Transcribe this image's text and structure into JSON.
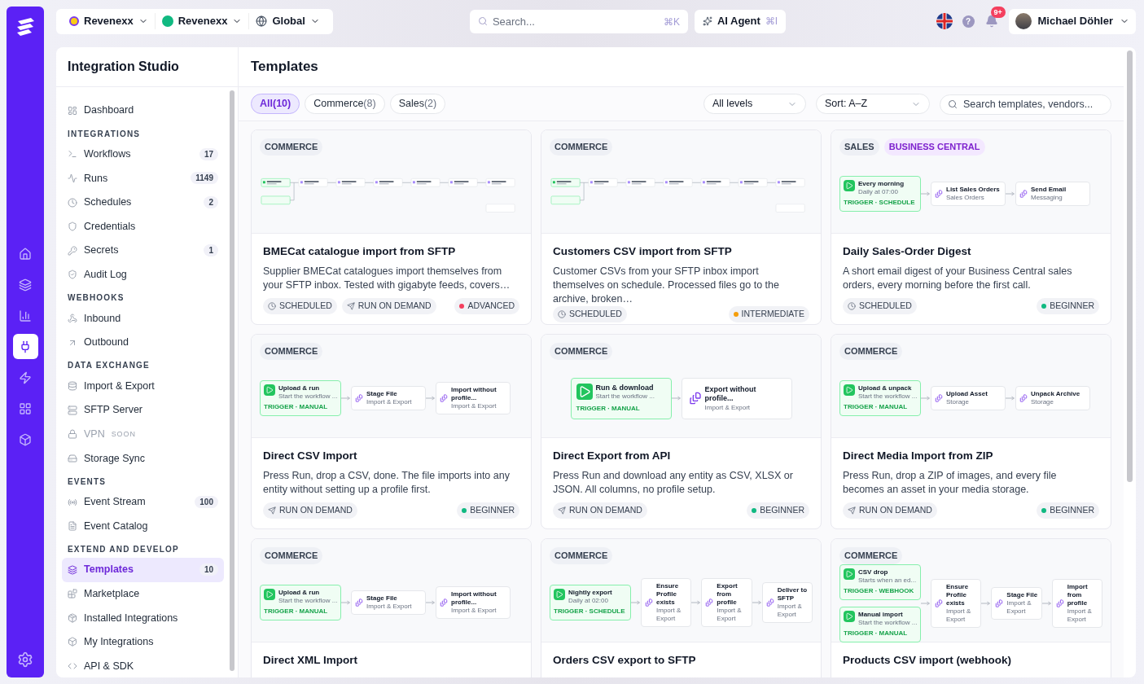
{
  "rail": [
    {
      "selected": false
    },
    {
      "selected": false
    },
    {
      "selected": false
    },
    {
      "selected": true
    },
    {
      "selected": false
    },
    {
      "selected": false
    },
    {
      "selected": false
    }
  ],
  "topbar": {
    "pickers": [
      {
        "label": "Revenexx"
      },
      {
        "label": "Revenexx"
      },
      {
        "label": "Global"
      }
    ],
    "search": {
      "placeholder": "Search...",
      "shortcut": "⌘K"
    },
    "ai_agent": {
      "label": "AI Agent",
      "shortcut": "⌘I"
    },
    "help": "?",
    "notifications": "9+",
    "user": "Michael Döhler"
  },
  "sidebar": {
    "title": "Integration Studio",
    "sections": [
      {
        "items": [
          {
            "label": "Dashboard",
            "selected": false,
            "disabled": false
          }
        ]
      },
      {
        "heading": "INTEGRATIONS",
        "items": [
          {
            "label": "Workflows",
            "count": "17",
            "selected": false,
            "disabled": false
          },
          {
            "label": "Runs",
            "count": "1149",
            "selected": false,
            "disabled": false
          },
          {
            "label": "Schedules",
            "count": "2",
            "selected": false,
            "disabled": false
          },
          {
            "label": "Credentials",
            "selected": false,
            "disabled": false
          },
          {
            "label": "Secrets",
            "count": "1",
            "selected": false,
            "disabled": false
          },
          {
            "label": "Audit Log",
            "selected": false,
            "disabled": false
          }
        ]
      },
      {
        "heading": "WEBHOOKS",
        "items": [
          {
            "label": "Inbound",
            "selected": false,
            "disabled": false
          },
          {
            "label": "Outbound",
            "selected": false,
            "disabled": false
          }
        ]
      },
      {
        "heading": "DATA EXCHANGE",
        "items": [
          {
            "label": "Import & Export",
            "selected": false,
            "disabled": false
          },
          {
            "label": "SFTP Server",
            "selected": false,
            "disabled": false
          },
          {
            "label": "VPN",
            "badge": "SOON",
            "selected": false,
            "disabled": true
          },
          {
            "label": "Storage Sync",
            "selected": false,
            "disabled": false
          }
        ]
      },
      {
        "heading": "EVENTS",
        "items": [
          {
            "label": "Event Stream",
            "count": "100",
            "selected": false,
            "disabled": false
          },
          {
            "label": "Event Catalog",
            "selected": false,
            "disabled": false
          }
        ]
      },
      {
        "heading": "EXTEND AND DEVELOP",
        "items": [
          {
            "label": "Templates",
            "count": "10",
            "selected": true,
            "disabled": false
          },
          {
            "label": "Marketplace",
            "selected": false,
            "disabled": false
          },
          {
            "label": "Installed Integrations",
            "selected": false,
            "disabled": false
          },
          {
            "label": "My Integrations",
            "selected": false,
            "disabled": false
          },
          {
            "label": "API & SDK",
            "selected": false,
            "disabled": false
          }
        ]
      }
    ]
  },
  "page": {
    "title": "Templates",
    "filters": [
      {
        "label": "All",
        "count": "(10)",
        "selected": true
      },
      {
        "label": "Commerce",
        "count": "(8)",
        "selected": false
      },
      {
        "label": "Sales",
        "count": "(2)",
        "selected": false
      }
    ],
    "level_select": "All levels",
    "sort_select": "Sort: A–Z",
    "search": {
      "placeholder": "Search templates, vendors..."
    }
  },
  "cards": [
    {
      "tags": [
        {
          "label": "COMMERCE",
          "kind": "category"
        }
      ],
      "preview": {
        "kind": "mini"
      },
      "title": "BMECat catalogue import from SFTP",
      "description": "Supplier BMECat catalogues import themselves from your SFTP inbox. Tested with gigabyte feeds, covers…",
      "badges": [
        {
          "label": "SCHEDULED",
          "kind": "scheduled"
        },
        {
          "label": "RUN ON DEMAND",
          "kind": "on-demand"
        }
      ],
      "level": {
        "label": "ADVANCED",
        "color": "#f43f5e"
      }
    },
    {
      "tags": [
        {
          "label": "COMMERCE",
          "kind": "category"
        }
      ],
      "preview": {
        "kind": "mini"
      },
      "title": "Customers CSV import from SFTP",
      "description": "Customer CSVs from your SFTP inbox import themselves on schedule. Processed files go to the archive, broken…",
      "badges": [
        {
          "label": "SCHEDULED",
          "kind": "scheduled"
        }
      ],
      "level": {
        "label": "INTERMEDIATE",
        "color": "#f59e0b"
      }
    },
    {
      "tags": [
        {
          "label": "SALES",
          "kind": "category"
        },
        {
          "label": "BUSINESS CENTRAL",
          "kind": "vendor"
        }
      ],
      "preview": {
        "kind": "flow",
        "triggers": [
          {
            "title": "Every morning",
            "sub": "Daily at 07:00",
            "label": "TRIGGER · SCHEDULE"
          }
        ],
        "steps": [
          {
            "title": "List Sales Orders",
            "sub": "Sales Orders"
          },
          {
            "title": "Send Email",
            "sub": "Messaging"
          }
        ]
      },
      "title": "Daily Sales-Order Digest",
      "description": "A short email digest of your Business Central sales orders, every morning before the first call.",
      "badges": [
        {
          "label": "SCHEDULED",
          "kind": "scheduled"
        }
      ],
      "level": {
        "label": "BEGINNER",
        "color": "#10b981"
      }
    },
    {
      "tags": [
        {
          "label": "COMMERCE",
          "kind": "category"
        }
      ],
      "preview": {
        "kind": "flow",
        "triggers": [
          {
            "title": "Upload & run",
            "sub": "Start the workflow ...",
            "label": "TRIGGER · MANUAL"
          }
        ],
        "steps": [
          {
            "title": "Stage File",
            "sub": "Import & Export"
          },
          {
            "title": "Import without profile...",
            "sub": "Import & Export"
          }
        ]
      },
      "title": "Direct CSV Import",
      "description": "Press Run, drop a CSV, done. The file imports into any entity without setting up a profile first.",
      "badges": [
        {
          "label": "RUN ON DEMAND",
          "kind": "on-demand"
        }
      ],
      "level": {
        "label": "BEGINNER",
        "color": "#10b981"
      }
    },
    {
      "tags": [
        {
          "label": "COMMERCE",
          "kind": "category"
        }
      ],
      "preview": {
        "kind": "large",
        "triggers": [
          {
            "title": "Run & download",
            "sub": "Start the workflow ...",
            "label": "TRIGGER · MANUAL"
          }
        ],
        "steps": [
          {
            "title": "Export without profile...",
            "sub": "Import & Export"
          }
        ]
      },
      "title": "Direct Export from API",
      "description": "Press Run and download any entity as CSV, XLSX or JSON. All columns, no profile setup.",
      "badges": [
        {
          "label": "RUN ON DEMAND",
          "kind": "on-demand"
        }
      ],
      "level": {
        "label": "BEGINNER",
        "color": "#10b981"
      }
    },
    {
      "tags": [
        {
          "label": "COMMERCE",
          "kind": "category"
        }
      ],
      "preview": {
        "kind": "flow",
        "triggers": [
          {
            "title": "Upload & unpack",
            "sub": "Start the workflow ...",
            "label": "TRIGGER · MANUAL"
          }
        ],
        "steps": [
          {
            "title": "Upload Asset",
            "sub": "Storage"
          },
          {
            "title": "Unpack Archive",
            "sub": "Storage"
          }
        ]
      },
      "title": "Direct Media Import from ZIP",
      "description": "Press Run, drop a ZIP of images, and every file becomes an asset in your media storage.",
      "badges": [
        {
          "label": "RUN ON DEMAND",
          "kind": "on-demand"
        }
      ],
      "level": {
        "label": "BEGINNER",
        "color": "#10b981"
      }
    },
    {
      "tags": [
        {
          "label": "COMMERCE",
          "kind": "category"
        }
      ],
      "preview": {
        "kind": "flow",
        "triggers": [
          {
            "title": "Upload & run",
            "sub": "Start the workflow ...",
            "label": "TRIGGER · MANUAL"
          }
        ],
        "steps": [
          {
            "title": "Stage File",
            "sub": "Import & Export"
          },
          {
            "title": "Import without profile...",
            "sub": "Import & Export"
          }
        ]
      },
      "title": "Direct XML Import"
    },
    {
      "tags": [
        {
          "label": "COMMERCE",
          "kind": "category"
        }
      ],
      "preview": {
        "kind": "flow",
        "triggers": [
          {
            "title": "Nightly export",
            "sub": "Daily at 02:00",
            "label": "TRIGGER · SCHEDULE"
          }
        ],
        "steps": [
          {
            "title": "Ensure Profile exists",
            "sub": "Import & Export"
          },
          {
            "title": "Export from profile",
            "sub": "Import & Export"
          },
          {
            "title": "Deliver to SFTP",
            "sub": "Import & Export"
          }
        ]
      },
      "title": "Orders CSV export to SFTP"
    },
    {
      "tags": [
        {
          "label": "COMMERCE",
          "kind": "category"
        }
      ],
      "preview": {
        "kind": "flow",
        "triggers": [
          {
            "title": "CSV drop",
            "sub": "Starts when an ed...",
            "label": "TRIGGER · WEBHOOK"
          },
          {
            "title": "Manual import",
            "sub": "Start the workflow ...",
            "label": "TRIGGER · MANUAL"
          }
        ],
        "steps": [
          {
            "title": "Ensure Profile exists",
            "sub": "Import & Export"
          },
          {
            "title": "Stage File",
            "sub": "Import & Export"
          },
          {
            "title": "Import from profile",
            "sub": "Import & Export"
          }
        ]
      },
      "title": "Products CSV import (webhook)"
    }
  ]
}
